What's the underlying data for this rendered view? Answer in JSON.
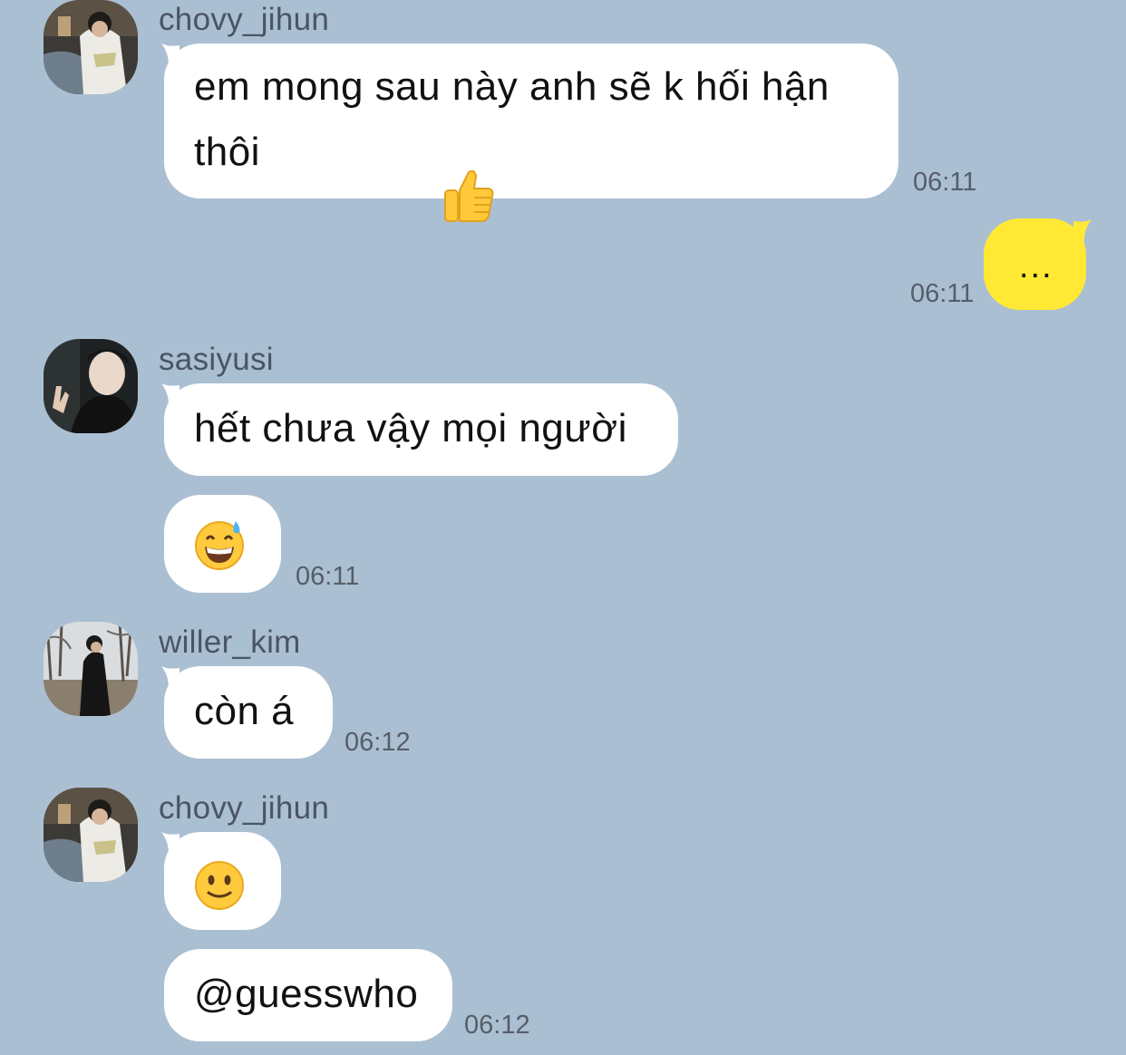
{
  "theme": {
    "background": "#abbfd3",
    "incoming_bubble": "#ffffff",
    "outgoing_bubble": "#ffe934",
    "timestamp_color": "#565e68",
    "sender_color": "#4a5563"
  },
  "messages": [
    {
      "sender": "chovy_jihun",
      "avatar": "chovy-jihun-avatar",
      "lines": [
        "em mong sau này anh sẽ k hối hận",
        "thôi"
      ],
      "emoji": "thumbs-up-emoji",
      "time": "06:11"
    },
    {
      "sender": "me",
      "text": "...",
      "time": "06:11"
    },
    {
      "sender": "sasiyusi",
      "avatar": "sasiyusi-avatar",
      "text": "hết chưa vậy mọi người",
      "emoji": "grinning-sweat-emoji",
      "time": "06:11"
    },
    {
      "sender": "willer_kim",
      "avatar": "willer-kim-avatar",
      "text": "còn á",
      "time": "06:12"
    },
    {
      "sender": "chovy_jihun",
      "avatar": "chovy-jihun-avatar",
      "emoji": "slightly-smiling-emoji",
      "text": "@guesswho",
      "time": "06:12"
    }
  ]
}
